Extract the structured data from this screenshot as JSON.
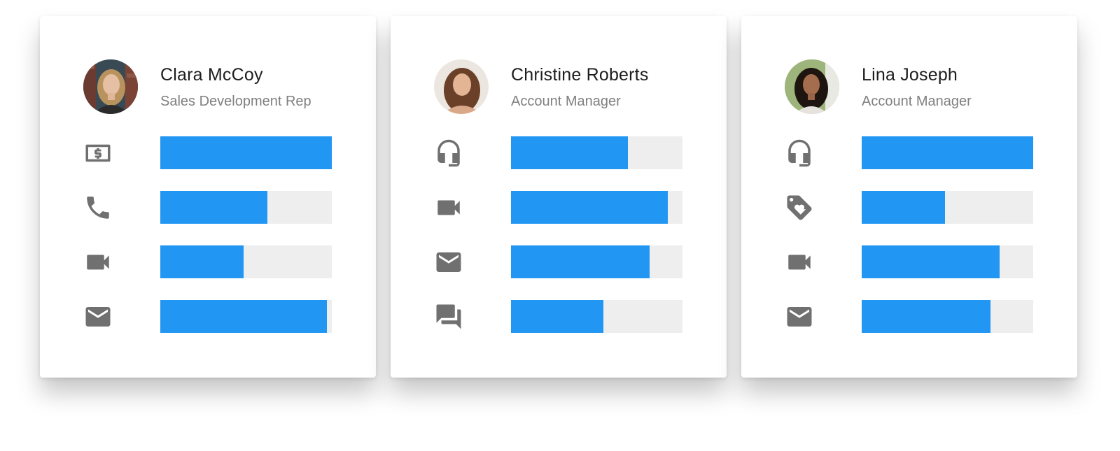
{
  "cards": [
    {
      "name": "Clara McCoy",
      "role": "Sales Development Rep",
      "metrics": [
        {
          "icon": "dollar-icon",
          "level": 1.0
        },
        {
          "icon": "phone-icon",
          "level": 0.625
        },
        {
          "icon": "video-camera-icon",
          "level": 0.485
        },
        {
          "icon": "email-icon",
          "level": 0.97
        }
      ]
    },
    {
      "name": "Christine Roberts",
      "role": "Account Manager",
      "metrics": [
        {
          "icon": "headset-icon",
          "level": 0.68
        },
        {
          "icon": "video-camera-icon",
          "level": 0.915
        },
        {
          "icon": "email-icon",
          "level": 0.81
        },
        {
          "icon": "chat-icon",
          "level": 0.54
        }
      ]
    },
    {
      "name": "Lina Joseph",
      "role": "Account Manager",
      "metrics": [
        {
          "icon": "headset-icon",
          "level": 1.0
        },
        {
          "icon": "tag-heart-icon",
          "level": 0.485
        },
        {
          "icon": "video-camera-icon",
          "level": 0.805
        },
        {
          "icon": "email-icon",
          "level": 0.75
        }
      ]
    }
  ],
  "colors": {
    "bar_fill": "#2196f3",
    "bar_track": "#eeeeee",
    "icon": "#707070",
    "name_text": "#1d1d1d",
    "role_text": "#808080"
  }
}
